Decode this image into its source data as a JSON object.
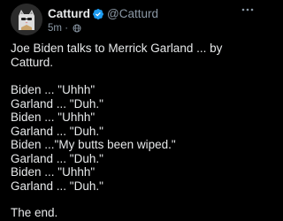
{
  "author": {
    "display_name": "Catturd",
    "handle": "@Catturd",
    "verified": true,
    "avatar_icon": "cat-avatar-icon"
  },
  "meta": {
    "timestamp": "5m",
    "separator": "·",
    "visibility_icon": "globe-icon"
  },
  "colors": {
    "background": "#000000",
    "text": "#e7e9ea",
    "muted": "#8b98a5",
    "verified_badge": "#1d9bf0"
  },
  "tweet": {
    "title": "Joe Biden talks to Merrick Garland ... by Catturd.",
    "dialogue": [
      "Biden ... \"Uhhh\"",
      "Garland ... \"Duh.\"",
      "Biden ... \"Uhhh\"",
      "Garland ... \"Duh.\"",
      "Biden ...\"My butts been wiped.\"",
      "Garland ... \"Duh.\"",
      "Biden ... \"Uhhh\"",
      "Garland ... \"Duh.\""
    ],
    "ending": "The end."
  }
}
